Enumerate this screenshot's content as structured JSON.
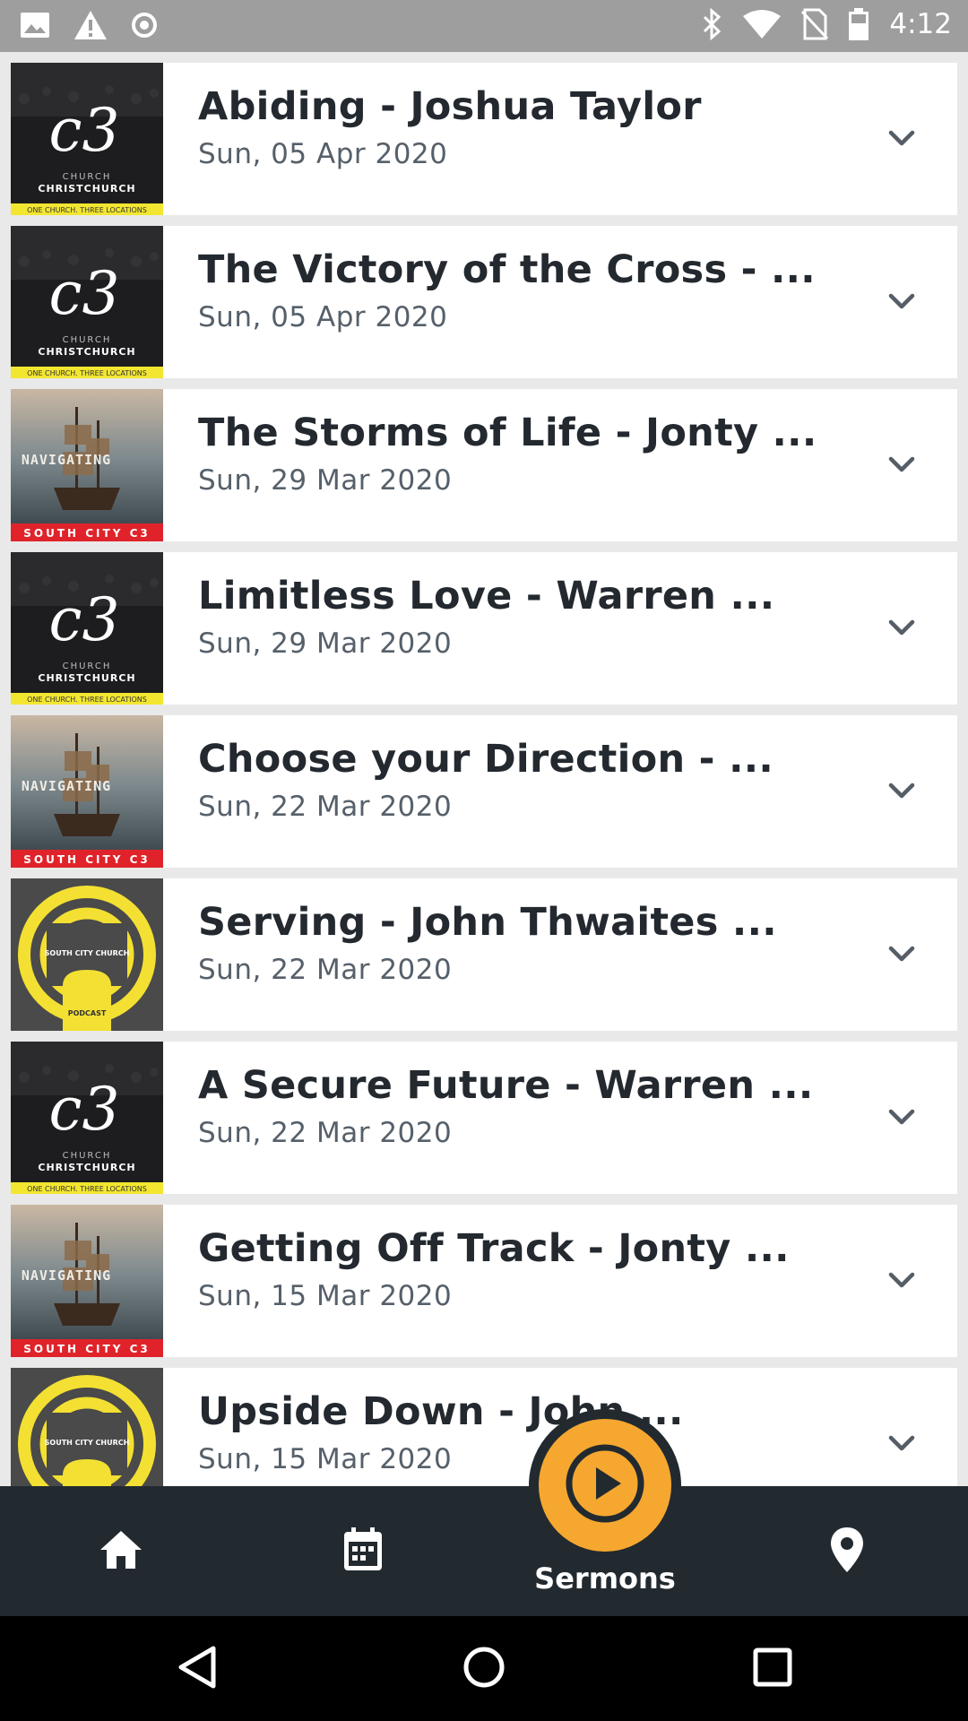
{
  "status_bar": {
    "time": "4:12",
    "left_icons": [
      "image-icon",
      "warning-icon",
      "sync-icon"
    ],
    "right_icons": [
      "bluetooth-icon",
      "wifi-icon",
      "no-sim-icon",
      "battery-icon"
    ]
  },
  "sermons": [
    {
      "title": "Abiding - Joshua Taylor",
      "date": "Sun, 05 Apr 2020",
      "art": "c3-christchurch"
    },
    {
      "title": "The Victory of the Cross - ...",
      "date": "Sun, 05 Apr 2020",
      "art": "c3-christchurch"
    },
    {
      "title": "The Storms of Life - Jonty ...",
      "date": "Sun, 29 Mar 2020",
      "art": "navigating"
    },
    {
      "title": "Limitless Love - Warren ...",
      "date": "Sun, 29 Mar 2020",
      "art": "c3-christchurch"
    },
    {
      "title": "Choose your Direction - ...",
      "date": "Sun, 22 Mar 2020",
      "art": "navigating"
    },
    {
      "title": "Serving - John Thwaites ...",
      "date": "Sun, 22 Mar 2020",
      "art": "podcast"
    },
    {
      "title": "A Secure Future - Warren ...",
      "date": "Sun, 22 Mar 2020",
      "art": "c3-christchurch"
    },
    {
      "title": "Getting Off Track - Jonty ...",
      "date": "Sun, 15 Mar 2020",
      "art": "navigating"
    },
    {
      "title": "Upside Down - John ...",
      "date": "Sun, 15 Mar 2020",
      "art": "podcast"
    }
  ],
  "artwork_text": {
    "c3_logo": "c3",
    "c3_church": "CHURCH",
    "c3_location": "CHRISTCHURCH",
    "c3_tagline": "ONE CHURCH. THREE LOCATIONS",
    "navigating": "NAVIGATING",
    "south_city": "SOUTH CITY C3",
    "podcast_church": "SOUTH CITY CHURCH",
    "podcast_label": "PODCAST"
  },
  "bottom_nav": {
    "items": [
      "home-icon",
      "calendar-icon",
      "play-icon",
      "location-pin-icon"
    ],
    "active_label": "Sermons"
  },
  "colors": {
    "accent": "#f6a72f",
    "nav_bg": "#222a30",
    "c3_yellow": "#f2e631",
    "south_city_red": "#e0232a",
    "podcast_yellow": "#f3e032"
  }
}
